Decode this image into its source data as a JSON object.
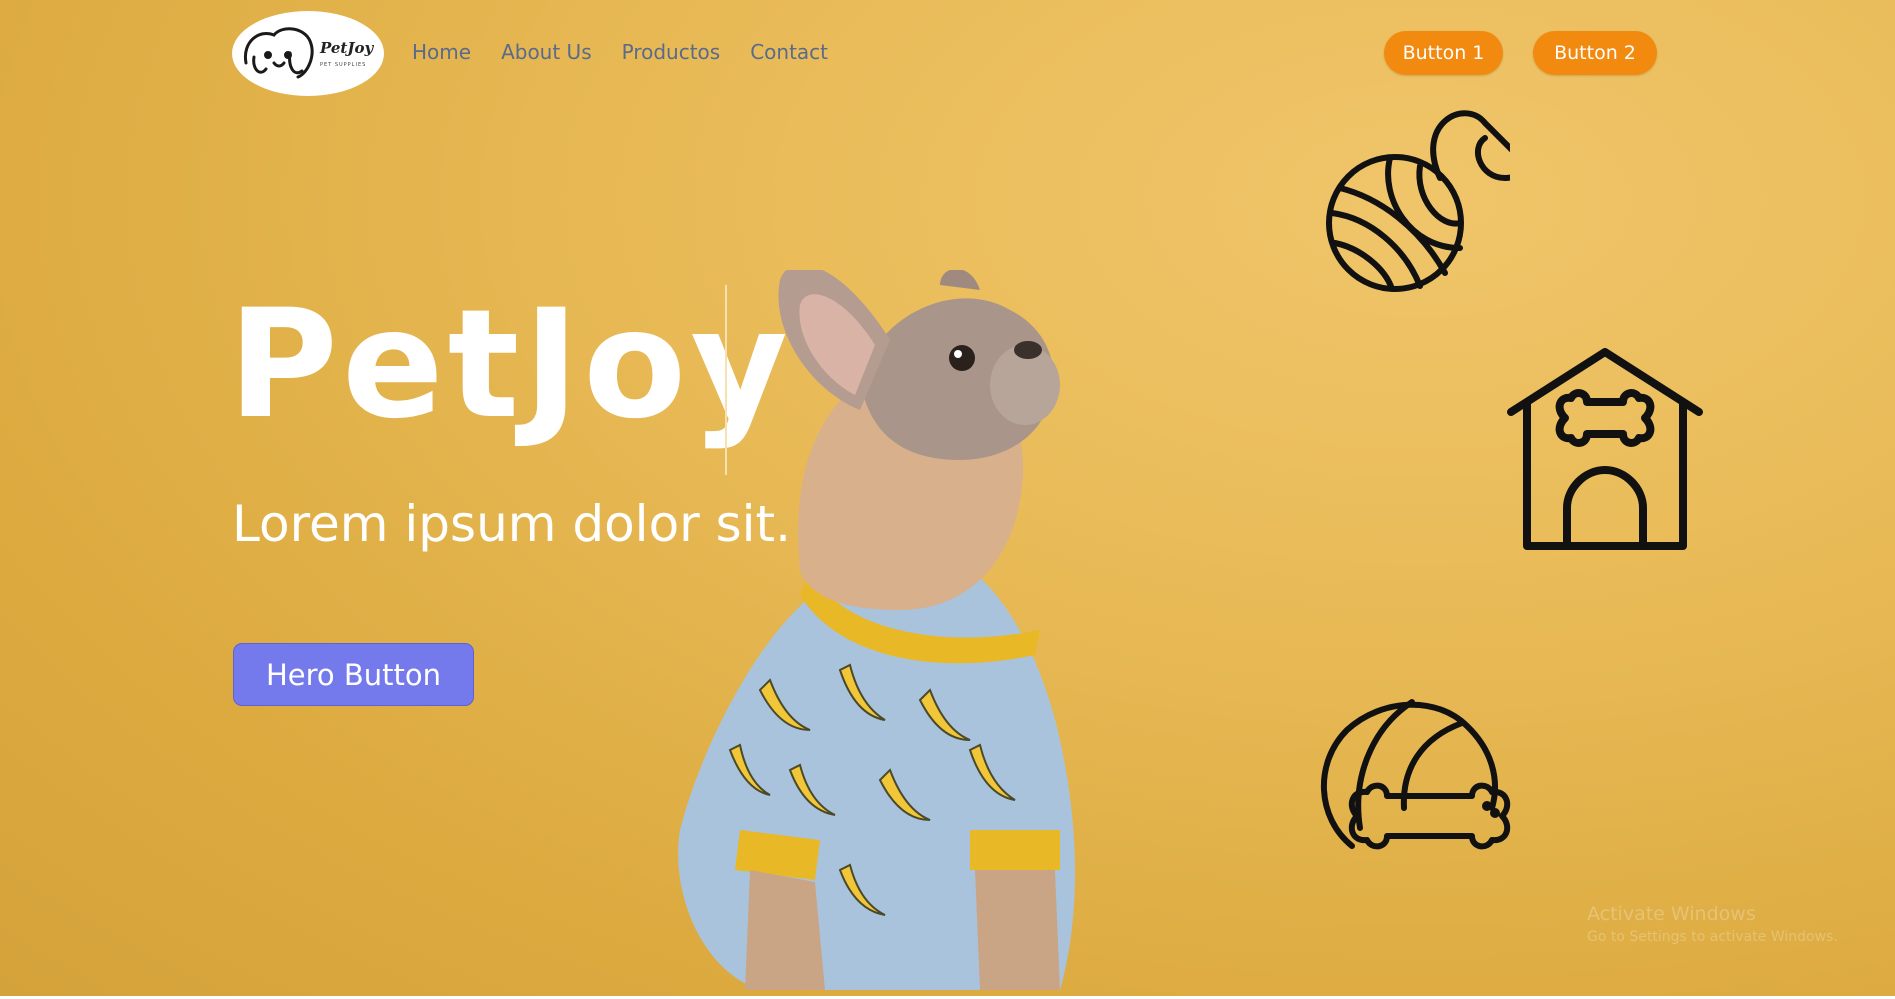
{
  "logo": {
    "name": "PetJoy",
    "subtitle": "PET SUPPLIES"
  },
  "nav": {
    "home": "Home",
    "about": "About Us",
    "products": "Productos",
    "contact": "Contact"
  },
  "header_buttons": {
    "button1": "Button 1",
    "button2": "Button 2"
  },
  "hero": {
    "title": "PetJoy",
    "tagline": "Lorem ipsum dolor sit.",
    "button": "Hero Button"
  },
  "icons": [
    "yarn-ball-icon",
    "dog-house-icon",
    "ball-and-bone-icon"
  ],
  "watermark": {
    "line1": "Activate Windows",
    "line2": "Go to Settings to activate Windows."
  },
  "colors": {
    "background": "#e9bb58",
    "accent_orange": "#f28a0f",
    "hero_button": "#7479ec",
    "nav_text": "#5a6a8a"
  }
}
